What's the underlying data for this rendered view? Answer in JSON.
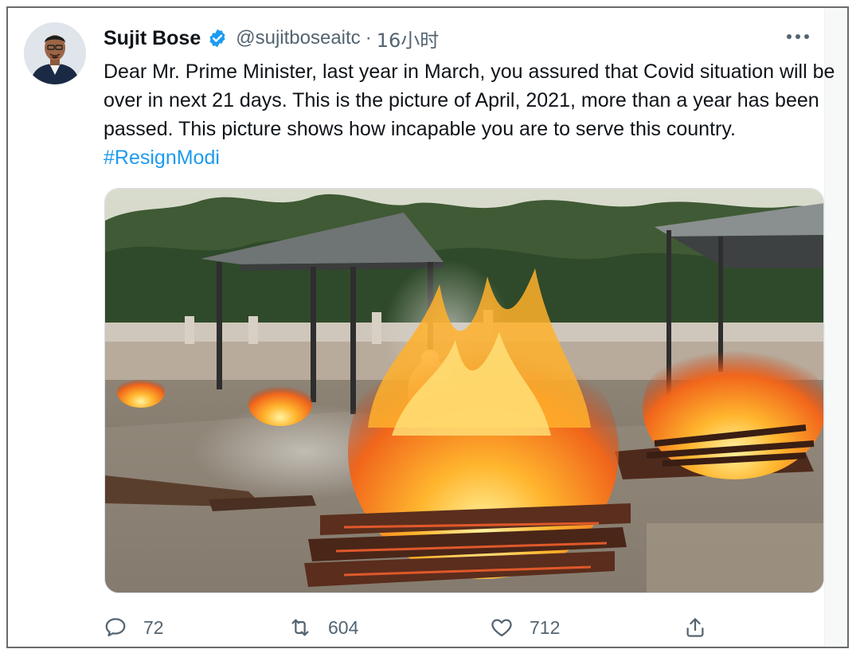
{
  "tweet": {
    "author": {
      "name": "Sujit Bose",
      "handle": "@sujitboseaitc",
      "verified": true
    },
    "separator": "·",
    "time": "16小时",
    "text_main": "Dear Mr. Prime Minister, last year in March, you assured that Covid situation will be over in next 21 days. This is the picture of April, 2021, more than a year has been passed. This picture shows how incapable you are to serve this country.",
    "hashtag": "#ResignModi",
    "media": {
      "description_icon": "photo"
    },
    "actions": {
      "reply_count": "72",
      "retweet_count": "604",
      "like_count": "712"
    }
  },
  "colors": {
    "text": "#0f1419",
    "secondary": "#536471",
    "link": "#1d9bf0",
    "verified": "#1d9bf0"
  }
}
